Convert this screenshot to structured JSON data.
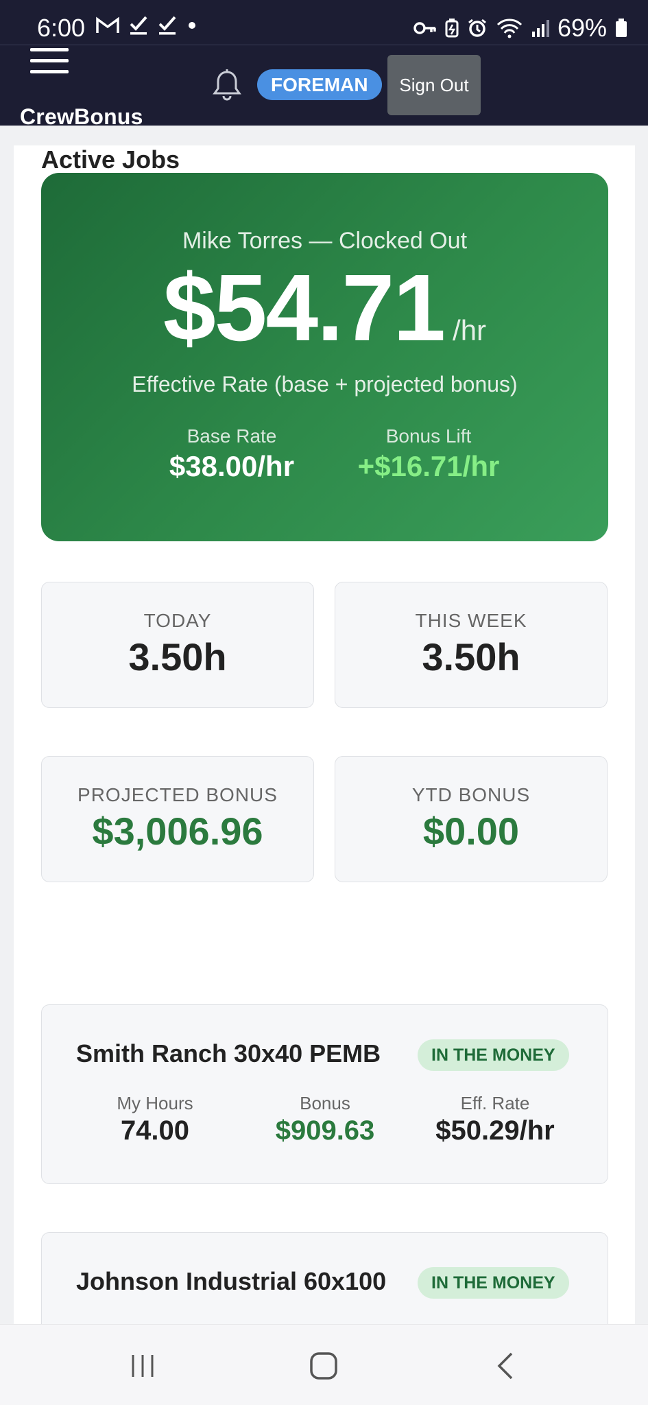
{
  "status_bar": {
    "time": "6:00",
    "battery": "69%",
    "left_icons": [
      "gmail-icon",
      "check-icon",
      "check-icon",
      "dot-icon"
    ],
    "right_icons": [
      "key-icon",
      "battery-saver-icon",
      "alarm-icon",
      "wifi-icon",
      "signal-icon",
      "battery-icon"
    ]
  },
  "header": {
    "brand": "CrewBonus",
    "role": "FOREMAN",
    "sign_out": "Sign Out"
  },
  "rate_card": {
    "name_status": "Mike Torres — Clocked Out",
    "effective_rate": "$54.71",
    "unit": "/hr",
    "description": "Effective Rate (base + projected bonus)",
    "base_rate_label": "Base Rate",
    "base_rate_value": "$38.00/hr",
    "bonus_lift_label": "Bonus Lift",
    "bonus_lift_value": "+$16.71/hr"
  },
  "stats": {
    "today_label": "TODAY",
    "today_value": "3.50h",
    "week_label": "THIS WEEK",
    "week_value": "3.50h",
    "projected_label": "PROJECTED BONUS",
    "projected_value": "$3,006.96",
    "ytd_label": "YTD BONUS",
    "ytd_value": "$0.00"
  },
  "active_jobs": {
    "title": "Active Jobs",
    "jobs": [
      {
        "name": "Smith Ranch 30x40 PEMB",
        "badge": "IN THE MONEY",
        "hours_label": "My Hours",
        "hours": "74.00",
        "bonus_label": "Bonus",
        "bonus": "$909.63",
        "rate_label": "Eff. Rate",
        "rate": "$50.29/hr"
      },
      {
        "name": "Johnson Industrial 60x100",
        "badge": "IN THE MONEY"
      }
    ]
  },
  "colors": {
    "header_bg": "#1c1d33",
    "role_badge": "#4a90e2",
    "rate_card": "#2e8a4a",
    "bonus_lift": "#86ee86",
    "money_green": "#2b7a3e",
    "badge_bg": "#d4eed9"
  },
  "nav": [
    "recents-icon",
    "home-icon",
    "back-icon"
  ]
}
